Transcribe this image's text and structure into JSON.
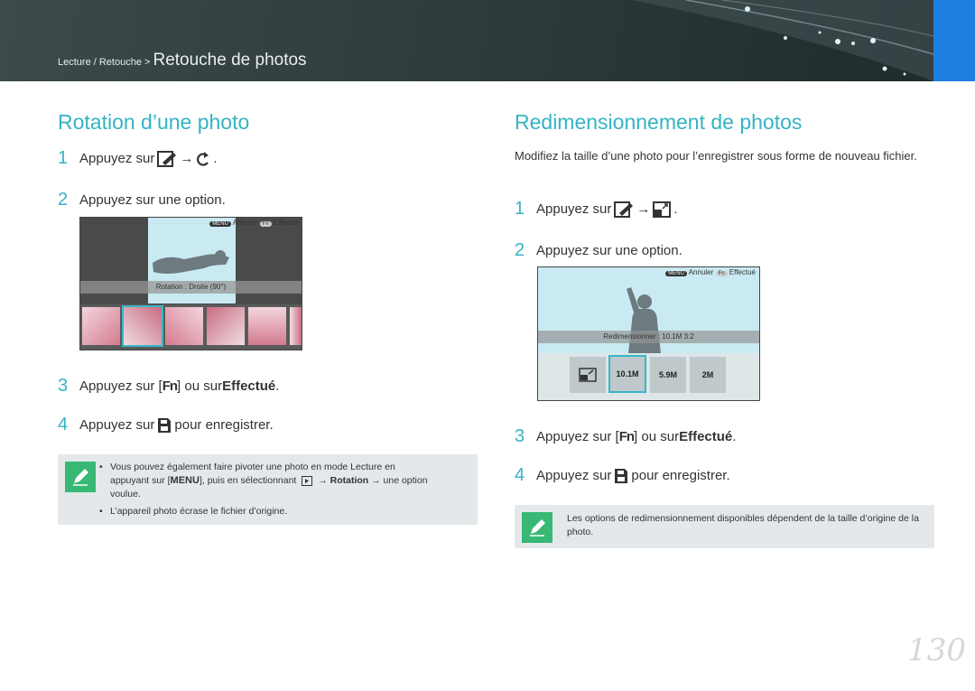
{
  "header": {
    "breadcrumb_prefix": "Lecture / Retouche > ",
    "breadcrumb_title": "Retouche de photos"
  },
  "left": {
    "title": "Rotation d’une photo",
    "steps": [
      {
        "num": "1",
        "text_a": "Appuyez sur",
        "arrow": "→",
        "text_b": "."
      },
      {
        "num": "2",
        "text": "Appuyez sur une option."
      },
      {
        "num": "3",
        "text_a": "Appuyez sur [",
        "text_b": "] ou sur ",
        "bold": "Effectué",
        "text_c": "."
      },
      {
        "num": "4",
        "text_a": "Appuyez sur",
        "text_b": "pour enregistrer."
      }
    ],
    "screen": {
      "cancel": "Annuler",
      "done": "Effectué",
      "caption": "Rotation : Droite (90°)",
      "menu_key": "MENU",
      "fn_key": "Fn"
    },
    "note": {
      "b1_a": "Vous pouvez également faire pivoter une photo en mode Lecture en",
      "b1_b": "appuyant sur [",
      "b1_menu": "MENU",
      "b1_c": "], puis en sélectionnant",
      "b1_arrow": "→",
      "b1_bold": "Rotation",
      "b1_d": "→ une option",
      "b1_e": "voulue.",
      "b2": "L’appareil photo écrase le fichier d’origine."
    }
  },
  "right": {
    "title": "Redimensionnement de photos",
    "desc": "Modifiez la taille d’une photo pour l’enregistrer sous forme de nouveau fichier.",
    "steps": [
      {
        "num": "1",
        "text_a": "Appuyez sur",
        "arrow": "→",
        "text_b": "."
      },
      {
        "num": "2",
        "text": "Appuyez sur une option."
      },
      {
        "num": "3",
        "text_a": "Appuyez sur [",
        "text_b": "] ou sur ",
        "bold": "Effectué",
        "text_c": "."
      },
      {
        "num": "4",
        "text_a": "Appuyez sur",
        "text_b": "pour enregistrer."
      }
    ],
    "screen": {
      "cancel": "Annuler",
      "done": "Effectué",
      "caption": "Redimensionner : 10.1M 3:2",
      "menu_key": "MENU",
      "fn_key": "Fn",
      "options": [
        "",
        "10.1M",
        "5.9M",
        "2M"
      ]
    },
    "note": {
      "text": "Les options de redimensionnement disponibles dépendent de la taille d’origine de la photo."
    }
  },
  "page_number": "130",
  "colors": {
    "accent": "#34b3c4",
    "note_icon": "#37b874",
    "tab": "#1e7fe0"
  }
}
